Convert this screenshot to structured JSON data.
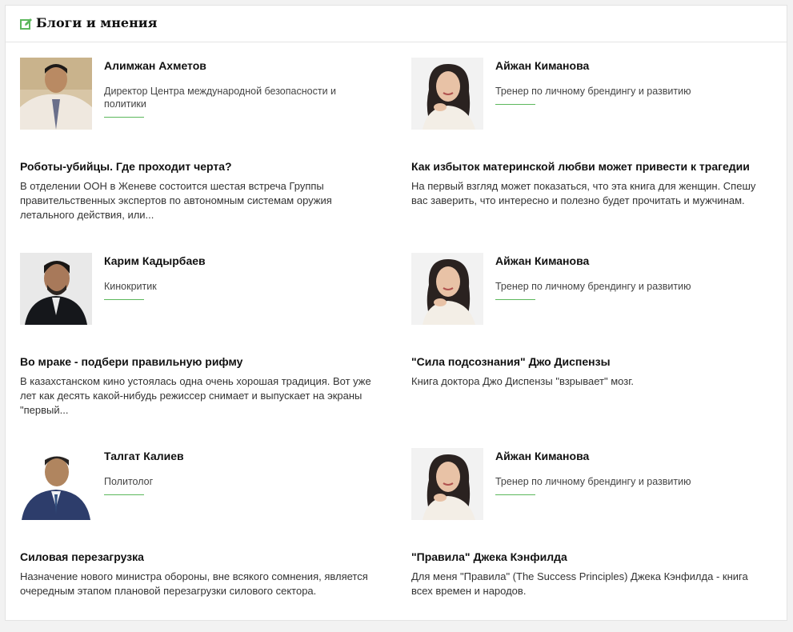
{
  "section": {
    "title": "Блоги и мнения",
    "icon": "edit-icon",
    "accent_color": "#5cb85c"
  },
  "posts": [
    {
      "author": "Алимжан Ахметов",
      "role": "Директор Центра международной безопасности и политики",
      "title": "Роботы-убийцы. Где проходит черта?",
      "excerpt": "В отделении ООН в Женеве состоится шестая встреча Группы правительственных экспертов по автономным системам оружия летального действия, или..."
    },
    {
      "author": "Айжан Киманова",
      "role": "Тренер по личному брендингу и развитию",
      "title": "Как избыток материнской любви может привести к трагедии",
      "excerpt": "На первый взгляд может показаться, что эта книга для женщин. Спешу вас заверить, что интересно и полезно будет прочитать и мужчинам."
    },
    {
      "author": "Карим Кадырбаев",
      "role": "Кинокритик",
      "title": "Во мраке - подбери правильную рифму",
      "excerpt": "В казахстанском кино устоялась одна очень хорошая традиция. Вот уже лет как десять какой-нибудь режиссер снимает и выпускает на экраны \"первый..."
    },
    {
      "author": "Айжан Киманова",
      "role": "Тренер по личному брендингу и развитию",
      "title": "\"Сила подсознания\" Джо Диспензы",
      "excerpt": "Книга доктора Джо Диспензы \"взрывает\" мозг."
    },
    {
      "author": "Талгат Калиев",
      "role": "Политолог",
      "title": "Силовая перезагрузка",
      "excerpt": "Назначение нового министра обороны, вне всякого сомнения, является очередным этапом плановой перезагрузки силового сектора."
    },
    {
      "author": "Айжан Киманова",
      "role": "Тренер по личному брендингу и развитию",
      "title": "\"Правила\" Джека Кэнфилда",
      "excerpt": "Для меня \"Правила\" (The Success Principles) Джека Кэнфилда - книга всех времен и народов."
    }
  ]
}
